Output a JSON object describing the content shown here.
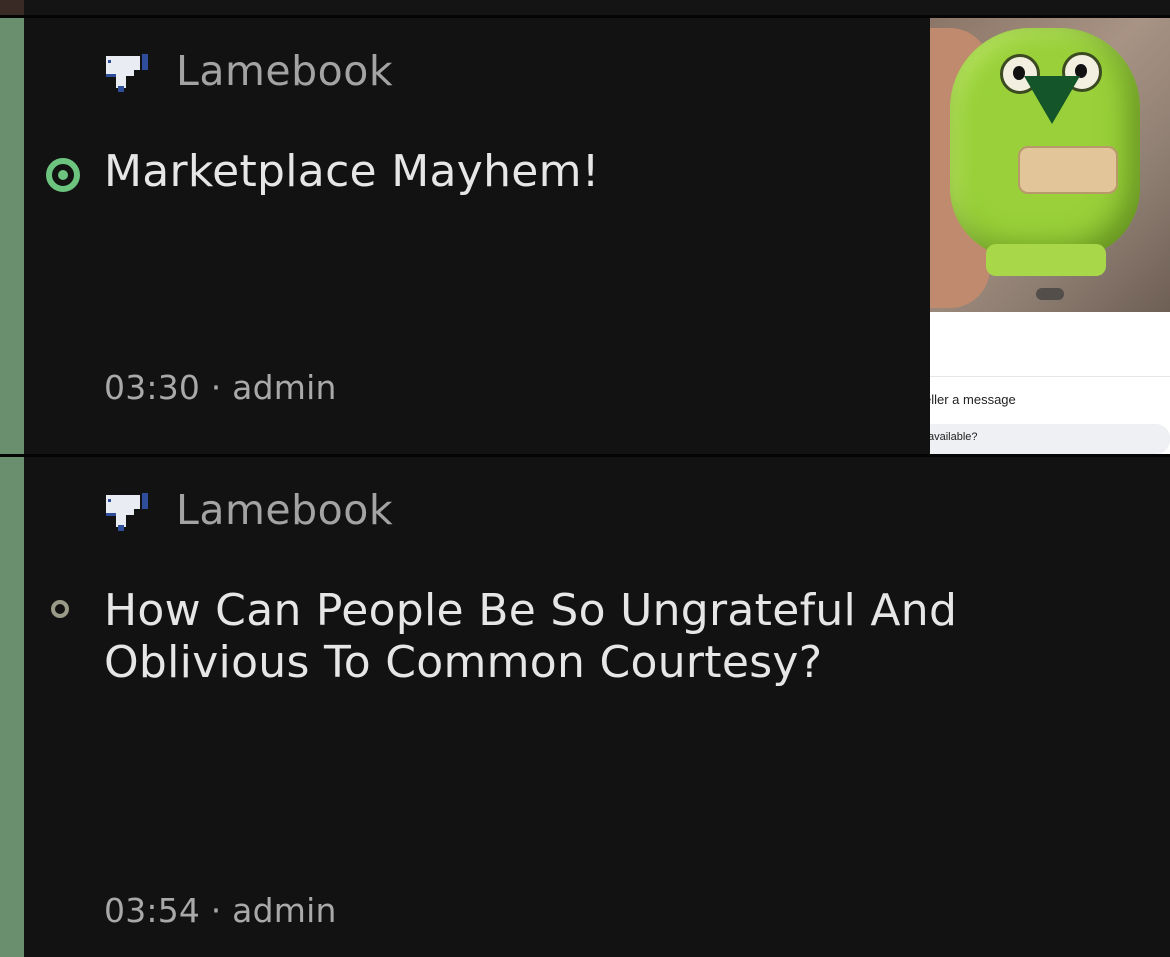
{
  "feed": {
    "items": [
      {
        "source": "Lamebook",
        "title": "Marketplace Mayhem!",
        "time": "03:30",
        "author": "admin",
        "meta": "03:30 · admin",
        "status": "unread",
        "thumbnail": {
          "message_label": "eller a message",
          "input_text": "available?"
        }
      },
      {
        "source": "Lamebook",
        "title": "How Can People Be So Ungrateful And Oblivious To Common Courtesy?",
        "time": "03:54",
        "author": "admin",
        "meta": "03:54 · admin",
        "status": "read"
      }
    ]
  },
  "colors": {
    "background": "#121212",
    "accent_bar": "#6a8f6e",
    "unread_dot": "#6cc47e",
    "read_dot": "#9a9a88",
    "title_text": "#e6e6e6",
    "meta_text": "#a9a9a9"
  },
  "icons": {
    "source_logo": "thumbs-down-icon",
    "unread_indicator": "unread-dot-icon",
    "read_indicator": "read-dot-icon"
  }
}
